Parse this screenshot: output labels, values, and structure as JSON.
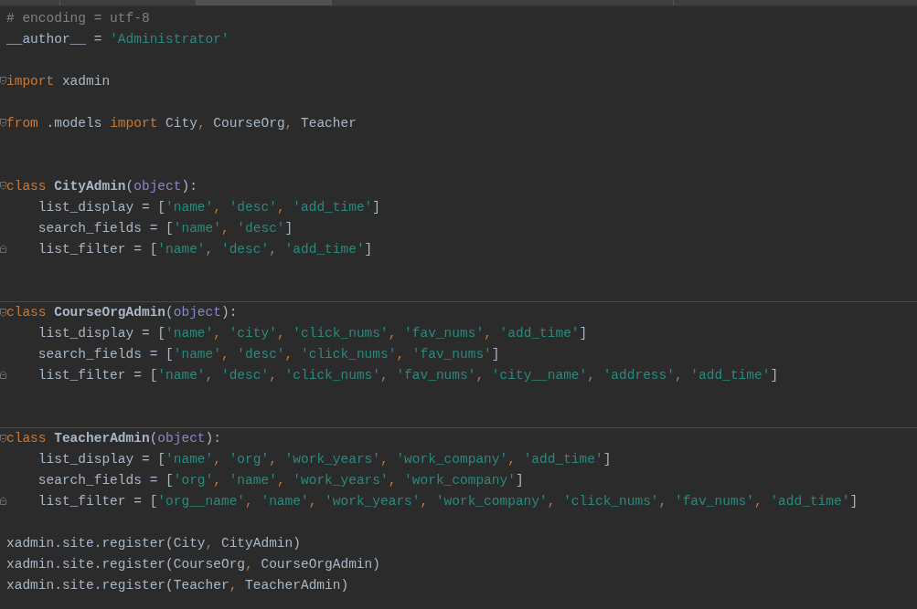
{
  "editor": {
    "lines": [
      {
        "kind": "code",
        "tokens": [
          {
            "kind": "comment",
            "t": "# encoding = utf-8"
          }
        ]
      },
      {
        "kind": "code",
        "tokens": [
          {
            "kind": "plain",
            "t": "__author__ = "
          },
          {
            "kind": "string",
            "t": "'Administrator'"
          }
        ]
      },
      {
        "kind": "blank"
      },
      {
        "kind": "code",
        "fold_start": true,
        "tokens": [
          {
            "kind": "keyword",
            "t": "import"
          },
          {
            "kind": "plain",
            "t": " xadmin"
          }
        ]
      },
      {
        "kind": "blank"
      },
      {
        "kind": "code",
        "fold_start": true,
        "tokens": [
          {
            "kind": "keyword",
            "t": "from"
          },
          {
            "kind": "plain",
            "t": " .models "
          },
          {
            "kind": "keyword",
            "t": "import"
          },
          {
            "kind": "plain",
            "t": " City"
          },
          {
            "kind": "comma",
            "t": ","
          },
          {
            "kind": "plain",
            "t": " CourseOrg"
          },
          {
            "kind": "comma",
            "t": ","
          },
          {
            "kind": "plain",
            "t": " Teacher"
          }
        ]
      },
      {
        "kind": "blank"
      },
      {
        "kind": "blank"
      },
      {
        "kind": "code",
        "fold_start": true,
        "tokens": [
          {
            "kind": "keyword",
            "t": "class"
          },
          {
            "kind": "name",
            "t": " CityAdmin"
          },
          {
            "kind": "plain",
            "t": "("
          },
          {
            "kind": "builtin",
            "t": "object"
          },
          {
            "kind": "plain",
            "t": "):"
          }
        ]
      },
      {
        "kind": "code",
        "tokens": [
          {
            "kind": "plain",
            "t": "    list_display = ["
          },
          {
            "kind": "string",
            "t": "'name'"
          },
          {
            "kind": "comma",
            "t": ","
          },
          {
            "kind": "string",
            "t": " 'desc'"
          },
          {
            "kind": "comma",
            "t": ","
          },
          {
            "kind": "string",
            "t": " 'add_time'"
          },
          {
            "kind": "plain",
            "t": "]"
          }
        ]
      },
      {
        "kind": "code",
        "tokens": [
          {
            "kind": "plain",
            "t": "    search_fields = ["
          },
          {
            "kind": "string",
            "t": "'name'"
          },
          {
            "kind": "comma",
            "t": ","
          },
          {
            "kind": "string",
            "t": " 'desc'"
          },
          {
            "kind": "plain",
            "t": "]"
          }
        ]
      },
      {
        "kind": "code",
        "fold_end": true,
        "tokens": [
          {
            "kind": "plain",
            "t": "    list_filter = ["
          },
          {
            "kind": "string",
            "t": "'name'"
          },
          {
            "kind": "comma",
            "t": ","
          },
          {
            "kind": "string",
            "t": " 'desc'"
          },
          {
            "kind": "comma",
            "t": ","
          },
          {
            "kind": "string",
            "t": " 'add_time'"
          },
          {
            "kind": "plain",
            "t": "]"
          }
        ]
      },
      {
        "kind": "blank"
      },
      {
        "kind": "blank"
      },
      {
        "kind": "code",
        "separator_above": true,
        "fold_start": true,
        "tokens": [
          {
            "kind": "keyword",
            "t": "class"
          },
          {
            "kind": "name",
            "t": " CourseOrgAdmin"
          },
          {
            "kind": "plain",
            "t": "("
          },
          {
            "kind": "builtin",
            "t": "object"
          },
          {
            "kind": "plain",
            "t": "):"
          }
        ]
      },
      {
        "kind": "code",
        "tokens": [
          {
            "kind": "plain",
            "t": "    list_display = ["
          },
          {
            "kind": "string",
            "t": "'name'"
          },
          {
            "kind": "comma",
            "t": ","
          },
          {
            "kind": "string",
            "t": " 'city'"
          },
          {
            "kind": "comma",
            "t": ","
          },
          {
            "kind": "string",
            "t": " 'click_nums'"
          },
          {
            "kind": "comma",
            "t": ","
          },
          {
            "kind": "string",
            "t": " 'fav_nums'"
          },
          {
            "kind": "comma",
            "t": ","
          },
          {
            "kind": "string",
            "t": " 'add_time'"
          },
          {
            "kind": "plain",
            "t": "]"
          }
        ]
      },
      {
        "kind": "code",
        "tokens": [
          {
            "kind": "plain",
            "t": "    search_fields = ["
          },
          {
            "kind": "string",
            "t": "'name'"
          },
          {
            "kind": "comma",
            "t": ","
          },
          {
            "kind": "string",
            "t": " 'desc'"
          },
          {
            "kind": "comma",
            "t": ","
          },
          {
            "kind": "string",
            "t": " 'click_nums'"
          },
          {
            "kind": "comma",
            "t": ","
          },
          {
            "kind": "string",
            "t": " 'fav_nums'"
          },
          {
            "kind": "plain",
            "t": "]"
          }
        ]
      },
      {
        "kind": "code",
        "fold_end": true,
        "tokens": [
          {
            "kind": "plain",
            "t": "    list_filter = ["
          },
          {
            "kind": "string",
            "t": "'name'"
          },
          {
            "kind": "comma",
            "t": ","
          },
          {
            "kind": "string",
            "t": " 'desc'"
          },
          {
            "kind": "comma",
            "t": ","
          },
          {
            "kind": "string",
            "t": " 'click_nums'"
          },
          {
            "kind": "comma",
            "t": ","
          },
          {
            "kind": "string",
            "t": " 'fav_nums'"
          },
          {
            "kind": "comma",
            "t": ","
          },
          {
            "kind": "string",
            "t": " 'city__name'"
          },
          {
            "kind": "comma",
            "t": ","
          },
          {
            "kind": "string",
            "t": " 'address'"
          },
          {
            "kind": "comma",
            "t": ","
          },
          {
            "kind": "string",
            "t": " 'add_time'"
          },
          {
            "kind": "plain",
            "t": "]"
          }
        ]
      },
      {
        "kind": "blank"
      },
      {
        "kind": "blank"
      },
      {
        "kind": "code",
        "separator_above": true,
        "fold_start": true,
        "tokens": [
          {
            "kind": "keyword",
            "t": "class"
          },
          {
            "kind": "name",
            "t": " TeacherAdmin"
          },
          {
            "kind": "plain",
            "t": "("
          },
          {
            "kind": "builtin",
            "t": "object"
          },
          {
            "kind": "plain",
            "t": "):"
          }
        ]
      },
      {
        "kind": "code",
        "tokens": [
          {
            "kind": "plain",
            "t": "    list_display = ["
          },
          {
            "kind": "string",
            "t": "'name'"
          },
          {
            "kind": "comma",
            "t": ","
          },
          {
            "kind": "string",
            "t": " 'org'"
          },
          {
            "kind": "comma",
            "t": ","
          },
          {
            "kind": "string",
            "t": " 'work_years'"
          },
          {
            "kind": "comma",
            "t": ","
          },
          {
            "kind": "string",
            "t": " 'work_company'"
          },
          {
            "kind": "comma",
            "t": ","
          },
          {
            "kind": "string",
            "t": " 'add_time'"
          },
          {
            "kind": "plain",
            "t": "]"
          }
        ]
      },
      {
        "kind": "code",
        "tokens": [
          {
            "kind": "plain",
            "t": "    search_fields = ["
          },
          {
            "kind": "string",
            "t": "'org'"
          },
          {
            "kind": "comma",
            "t": ","
          },
          {
            "kind": "string",
            "t": " 'name'"
          },
          {
            "kind": "comma",
            "t": ","
          },
          {
            "kind": "string",
            "t": " 'work_years'"
          },
          {
            "kind": "comma",
            "t": ","
          },
          {
            "kind": "string",
            "t": " 'work_company'"
          },
          {
            "kind": "plain",
            "t": "]"
          }
        ]
      },
      {
        "kind": "code",
        "fold_end": true,
        "tokens": [
          {
            "kind": "plain",
            "t": "    list_filter = ["
          },
          {
            "kind": "string",
            "t": "'org__name'"
          },
          {
            "kind": "comma",
            "t": ","
          },
          {
            "kind": "string",
            "t": " 'name'"
          },
          {
            "kind": "comma",
            "t": ","
          },
          {
            "kind": "string",
            "t": " 'work_years'"
          },
          {
            "kind": "comma",
            "t": ","
          },
          {
            "kind": "string",
            "t": " 'work_company'"
          },
          {
            "kind": "comma",
            "t": ","
          },
          {
            "kind": "string",
            "t": " 'click_nums'"
          },
          {
            "kind": "comma",
            "t": ","
          },
          {
            "kind": "string",
            "t": " 'fav_nums'"
          },
          {
            "kind": "comma",
            "t": ","
          },
          {
            "kind": "string",
            "t": " 'add_time'"
          },
          {
            "kind": "plain",
            "t": "]"
          }
        ]
      },
      {
        "kind": "blank"
      },
      {
        "kind": "code",
        "tokens": [
          {
            "kind": "plain",
            "t": "xadmin.site.register(City"
          },
          {
            "kind": "comma",
            "t": ","
          },
          {
            "kind": "plain",
            "t": " CityAdmin)"
          }
        ]
      },
      {
        "kind": "code",
        "tokens": [
          {
            "kind": "plain",
            "t": "xadmin.site.register(CourseOrg"
          },
          {
            "kind": "comma",
            "t": ","
          },
          {
            "kind": "plain",
            "t": " CourseOrgAdmin)"
          }
        ]
      },
      {
        "kind": "code",
        "tokens": [
          {
            "kind": "plain",
            "t": "xadmin.site.register(Teacher"
          },
          {
            "kind": "comma",
            "t": ","
          },
          {
            "kind": "plain",
            "t": " TeacherAdmin)"
          }
        ]
      }
    ]
  }
}
